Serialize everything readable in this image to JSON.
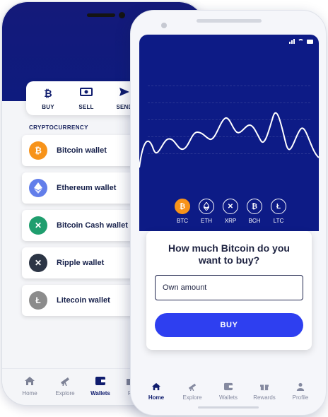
{
  "back_phone": {
    "actions": [
      {
        "label": "BUY",
        "icon": "bitcoin-icon"
      },
      {
        "label": "SELL",
        "icon": "cash-icon"
      },
      {
        "label": "SEND",
        "icon": "send-icon"
      }
    ],
    "section_label": "CRYPTOCURRENCY",
    "wallets": [
      {
        "label": "Bitcoin wallet",
        "icon": "bitcoin-icon",
        "color": "#f7931a"
      },
      {
        "label": "Ethereum wallet",
        "icon": "ethereum-icon",
        "color": "#627eea"
      },
      {
        "label": "Bitcoin Cash wallet",
        "icon": "bitcoin-cash-icon",
        "color": "#1f9e6e"
      },
      {
        "label": "Ripple wallet",
        "icon": "ripple-icon",
        "color": "#2c3545"
      },
      {
        "label": "Litecoin wallet",
        "icon": "litecoin-icon",
        "color": "#8c8c8c"
      }
    ],
    "tabs": [
      {
        "label": "Home",
        "icon": "home-icon"
      },
      {
        "label": "Explore",
        "icon": "telescope-icon"
      },
      {
        "label": "Wallets",
        "icon": "wallet-icon",
        "active": true
      },
      {
        "label": "Re",
        "icon": "rewards-icon"
      }
    ]
  },
  "front_phone": {
    "coins": [
      {
        "label": "BTC",
        "icon": "bitcoin-icon",
        "selected": true
      },
      {
        "label": "ETH",
        "icon": "ethereum-icon"
      },
      {
        "label": "XRP",
        "icon": "ripple-icon"
      },
      {
        "label": "BCH",
        "icon": "bitcoin-cash-icon"
      },
      {
        "label": "LTC",
        "icon": "litecoin-icon"
      }
    ],
    "buy_question": "How much Bitcoin do you want to buy?",
    "amount_placeholder": "Own amount",
    "buy_button": "BUY",
    "tabs": [
      {
        "label": "Home",
        "icon": "home-icon",
        "active": true
      },
      {
        "label": "Explore",
        "icon": "telescope-icon"
      },
      {
        "label": "Wallets",
        "icon": "wallet-icon"
      },
      {
        "label": "Rewards",
        "icon": "gift-icon"
      },
      {
        "label": "Profile",
        "icon": "profile-icon"
      }
    ]
  },
  "colors": {
    "navy": "#0d1b86",
    "accent": "#2e3ff0",
    "bitcoin_orange": "#f7931a"
  }
}
